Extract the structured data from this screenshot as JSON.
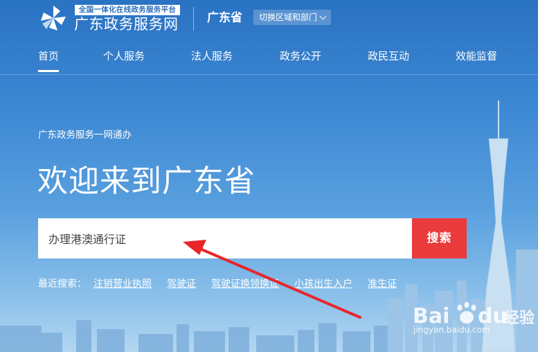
{
  "header": {
    "logo_tag": "全国一体化在线政务服务平台",
    "logo_name": "广东政务服务网",
    "province": "广东省",
    "switch_label": "切换区域和部门"
  },
  "nav": {
    "items": [
      {
        "label": "首页",
        "active": true
      },
      {
        "label": "个人服务",
        "active": false
      },
      {
        "label": "法人服务",
        "active": false
      },
      {
        "label": "政务公开",
        "active": false
      },
      {
        "label": "政民互动",
        "active": false
      },
      {
        "label": "效能监督",
        "active": false
      }
    ]
  },
  "hero": {
    "subtitle": "广东政务服务一网通办",
    "welcome": "欢迎来到广东省"
  },
  "search": {
    "value": "办理港澳通行证",
    "button_label": "搜索"
  },
  "recent": {
    "label": "最近搜索：",
    "links": [
      "注销营业执照",
      "驾驶证",
      "驾驶证换领换证",
      "小孩出生入户",
      "准生证"
    ]
  },
  "watermark": {
    "text": "Bai du 经验",
    "sub": "jingyan.baidu.com"
  },
  "colors": {
    "search_button": "#e93b3b",
    "annotation_arrow": "#e8262a"
  }
}
